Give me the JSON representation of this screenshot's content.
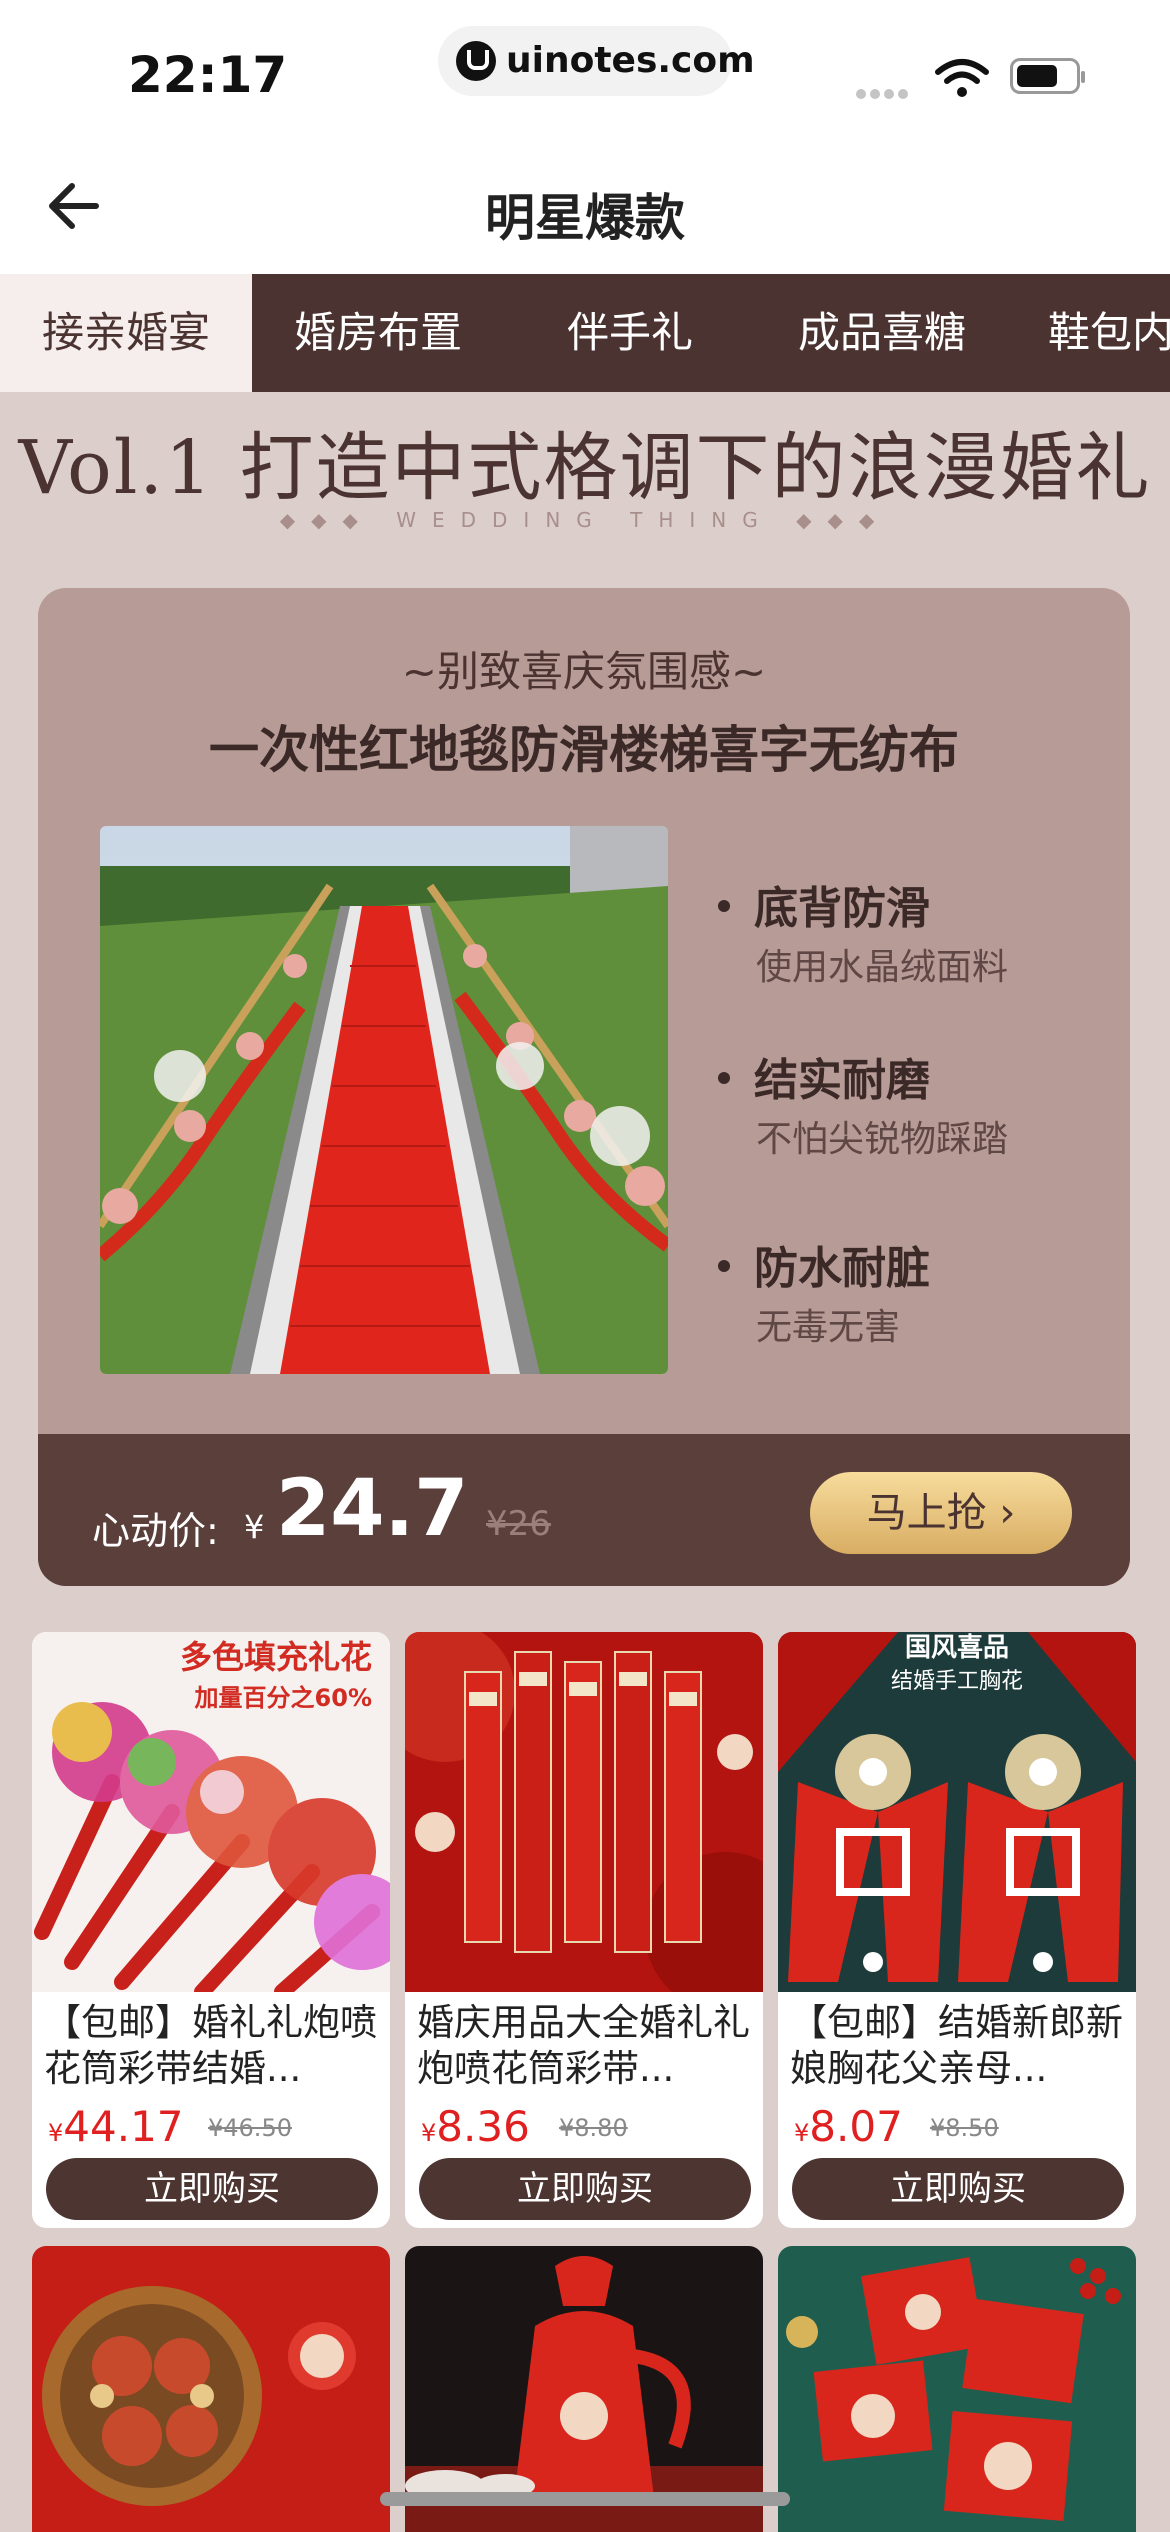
{
  "status_bar": {
    "time": "22:17",
    "url": "uinotes.com"
  },
  "nav": {
    "title": "明星爆款"
  },
  "tabs": [
    {
      "label": "接亲婚宴",
      "active": true
    },
    {
      "label": "婚房布置",
      "active": false
    },
    {
      "label": "伴手礼",
      "active": false
    },
    {
      "label": "成品喜糖",
      "active": false
    },
    {
      "label": "鞋包内",
      "active": false
    }
  ],
  "hero": {
    "title": "Vol.1  打造中式格调下的浪漫婚礼",
    "subtitle": "◆◆◆ WEDDING THING ◆◆◆"
  },
  "feature_card": {
    "tag": "~别致喜庆氛围感~",
    "title": "一次性红地毯防滑楼梯喜字无纺布",
    "features": [
      {
        "name": "底背防滑",
        "desc": "使用水晶绒面料"
      },
      {
        "name": "结实耐磨",
        "desc": "不怕尖锐物踩踏"
      },
      {
        "name": "防水耐脏",
        "desc": "无毒无害"
      }
    ],
    "price_label": "心动价:",
    "currency": "¥",
    "price": "24.7",
    "old_price": "¥26",
    "buy_label": "马上抢 ›"
  },
  "products": [
    {
      "name": "【包邮】婚礼礼炮喷花筒彩带结婚...",
      "currency": "¥",
      "price": "44.17",
      "old_price": "¥46.50",
      "button": "立即购买",
      "img_title": "多色填充礼花",
      "img_sub": "加量百分之60%"
    },
    {
      "name": "婚庆用品大全婚礼礼炮喷花筒彩带...",
      "currency": "¥",
      "price": "8.36",
      "old_price": "¥8.80",
      "button": "立即购买"
    },
    {
      "name": "【包邮】结婚新郎新娘胸花父亲母...",
      "currency": "¥",
      "price": "8.07",
      "old_price": "¥8.50",
      "button": "立即购买",
      "img_title": "国风喜品",
      "img_sub": "结婚手工胸花"
    }
  ],
  "colors": {
    "page_bg": "#dccfcb",
    "tab_bar": "#4a3330",
    "card_bg": "#b79b96",
    "price_bar": "#5a3f3b",
    "buy_gold": "#e6c27c",
    "price_red": "#e02020"
  }
}
